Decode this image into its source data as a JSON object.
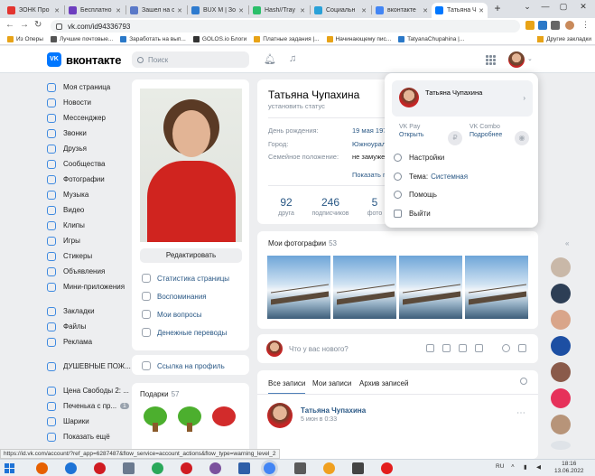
{
  "browser": {
    "tabs": [
      {
        "label": "ЗОНК Про",
        "color": "#e3342f"
      },
      {
        "label": "Бесплатно",
        "color": "#6d3ebf"
      },
      {
        "label": "Зашел на с",
        "color": "#5a79c8"
      },
      {
        "label": "BUX M | Зо",
        "color": "#2e7bcf"
      },
      {
        "label": "Hash//Tray",
        "color": "#2bbf6a"
      },
      {
        "label": "Социальн",
        "color": "#2aa1d8"
      },
      {
        "label": "вконтакте",
        "color": "#4285f4"
      },
      {
        "label": "Татьяна Чу",
        "color": "#0077ff"
      }
    ],
    "active_tab_index": 7,
    "new_tab_label": "+",
    "window_controls": [
      "⌄",
      "—",
      "▢",
      "✕"
    ],
    "url": "vk.com/id94336793",
    "bookmarks": [
      {
        "label": "Из Оперы",
        "color": "#e8a317"
      },
      {
        "label": "Лучшие почтовые...",
        "color": "#555555"
      },
      {
        "label": "Заработать на вып...",
        "color": "#2a78c8"
      },
      {
        "label": "GOLOS.io Блоги",
        "color": "#333333"
      },
      {
        "label": "Платные задания |...",
        "color": "#e8a317"
      },
      {
        "label": "Начинающему пис...",
        "color": "#e8a317"
      },
      {
        "label": "TatyanaChupahina |...",
        "color": "#2a78c8"
      }
    ],
    "bookmarks_other": "Другие закладки",
    "status_url": "https://id.vk.com/account/?ref_app=6287487&flow_service=account_actions&flow_type=warning_level_2"
  },
  "vk": {
    "logo_text": "вконтакте",
    "search_placeholder": "Поиск",
    "menu": [
      {
        "label": "Моя страница",
        "icon": "user-icon"
      },
      {
        "label": "Новости",
        "icon": "news-icon"
      },
      {
        "label": "Мессенджер",
        "icon": "message-icon"
      },
      {
        "label": "Звонки",
        "icon": "phone-icon"
      },
      {
        "label": "Друзья",
        "icon": "friends-icon"
      },
      {
        "label": "Сообщества",
        "icon": "community-icon"
      },
      {
        "label": "Фотографии",
        "icon": "photo-icon"
      },
      {
        "label": "Музыка",
        "icon": "music-icon"
      },
      {
        "label": "Видео",
        "icon": "video-icon"
      },
      {
        "label": "Клипы",
        "icon": "clips-icon"
      },
      {
        "label": "Игры",
        "icon": "games-icon"
      },
      {
        "label": "Стикеры",
        "icon": "sticker-icon"
      },
      {
        "label": "Объявления",
        "icon": "ads-icon"
      },
      {
        "label": "Мини-приложения",
        "icon": "apps-icon"
      }
    ],
    "menu2": [
      {
        "label": "Закладки",
        "icon": "bookmark-icon"
      },
      {
        "label": "Файлы",
        "icon": "file-icon"
      },
      {
        "label": "Реклама",
        "icon": "megaphone-icon"
      }
    ],
    "menu3": [
      {
        "label": "ДУШЕВНЫЕ ПОЖ...",
        "icon": "group-icon"
      }
    ],
    "menu4": [
      {
        "label": "Цена Свободы 2: ...",
        "icon": "game-icon",
        "badge": ""
      },
      {
        "label": "Печенька с пр...",
        "icon": "game-icon",
        "badge": "1"
      },
      {
        "label": "Шарики",
        "icon": "game-icon",
        "badge": ""
      },
      {
        "label": "Показать ещё",
        "icon": "chevron-down-icon",
        "badge": ""
      }
    ]
  },
  "profile": {
    "name": "Татьяна Чупахина",
    "status_placeholder": "установить статус",
    "edit_button": "Редактировать",
    "side_links": [
      "Статистика страницы",
      "Воспоминания",
      "Мои вопросы",
      "Денежные переводы"
    ],
    "profile_link": "Ссылка на профиль",
    "info": [
      {
        "label": "День рождения:",
        "value": "19 мая 197"
      },
      {
        "label": "Город:",
        "value": "Южноурал"
      },
      {
        "label": "Семейное положение:",
        "value": "не замуже"
      }
    ],
    "show_more": "Показать п",
    "stats": [
      {
        "num": "92",
        "label": "друга"
      },
      {
        "num": "246",
        "label": "подписчиков"
      },
      {
        "num": "5",
        "label": "фото"
      }
    ],
    "gifts_title": "Подарки",
    "gifts_count": "57"
  },
  "photos": {
    "title": "Мои фотографии",
    "count": "53"
  },
  "composer": {
    "placeholder": "Что у вас нового?"
  },
  "wall": {
    "tabs": [
      "Все записи",
      "Мои записи",
      "Архив записей"
    ],
    "post": {
      "author": "Татьяна Чупахина",
      "time": "5 июн в 0:33"
    }
  },
  "dropdown": {
    "name": "Татьяна Чупахина",
    "vkpay_title": "VK Pay",
    "vkpay_action": "Открыть",
    "combo_title": "VK Combo",
    "combo_action": "Подробнее",
    "settings": "Настройки",
    "theme_label": "Тема:",
    "theme_value": "Системная",
    "help": "Помощь",
    "logout": "Выйти"
  },
  "taskbar": {
    "lang": "RU",
    "time": "18:16",
    "date": "13.06.2022"
  }
}
